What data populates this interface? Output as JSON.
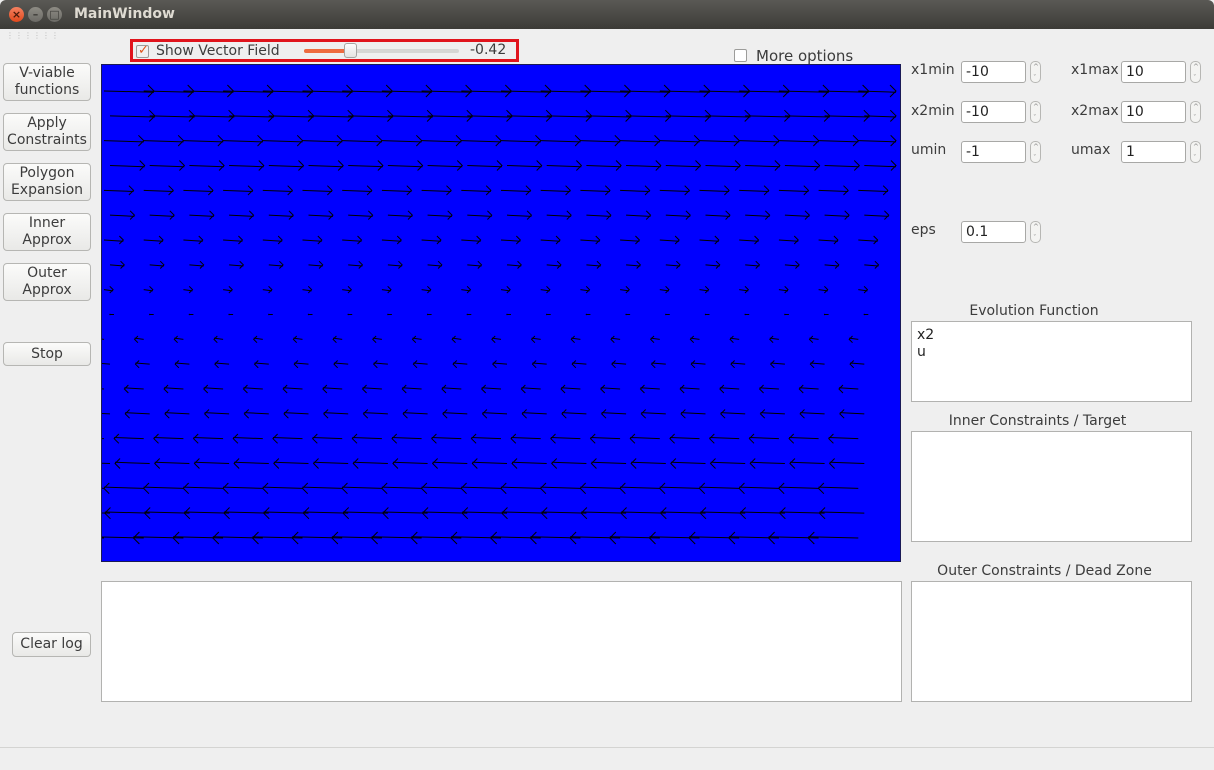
{
  "window": {
    "title": "MainWindow"
  },
  "toolbar_grip": "⋮⋮⋮⋮⋮⋮",
  "left_buttons": [
    {
      "label": "V-viable\nfunctions"
    },
    {
      "label": "Apply\nConstraints"
    },
    {
      "label": "Polygon\nExpansion"
    },
    {
      "label": "Inner\nApprox"
    },
    {
      "label": "Outer\nApprox"
    },
    {
      "label": "Stop"
    },
    {
      "label": "Clear log"
    }
  ],
  "vector_field": {
    "checked": true,
    "label": "Show Vector Field",
    "slider_value": "-0.42",
    "slider_fraction": 0.29
  },
  "more_options": {
    "checked": false,
    "label": "More options"
  },
  "params": {
    "x1min": {
      "label": "x1min",
      "value": "-10"
    },
    "x1max": {
      "label": "x1max",
      "value": "10"
    },
    "x2min": {
      "label": "x2min",
      "value": "-10"
    },
    "x2max": {
      "label": "x2max",
      "value": "10"
    },
    "umin": {
      "label": "umin",
      "value": "-1"
    },
    "umax": {
      "label": "umax",
      "value": "1"
    },
    "eps": {
      "label": "eps",
      "value": "0.1"
    }
  },
  "evolution_function": {
    "title": "Evolution Function",
    "text": "x2\nu"
  },
  "inner_constraints": {
    "title": "Inner Constraints / Target",
    "text": ""
  },
  "outer_constraints": {
    "title": "Outer Constraints / Dead Zone",
    "text": ""
  },
  "log": {
    "text": ""
  },
  "colors": {
    "plot_background": "#0000ff",
    "accent": "#e0541c",
    "highlight_box": "#e0141c",
    "arrows": "#000000"
  }
}
